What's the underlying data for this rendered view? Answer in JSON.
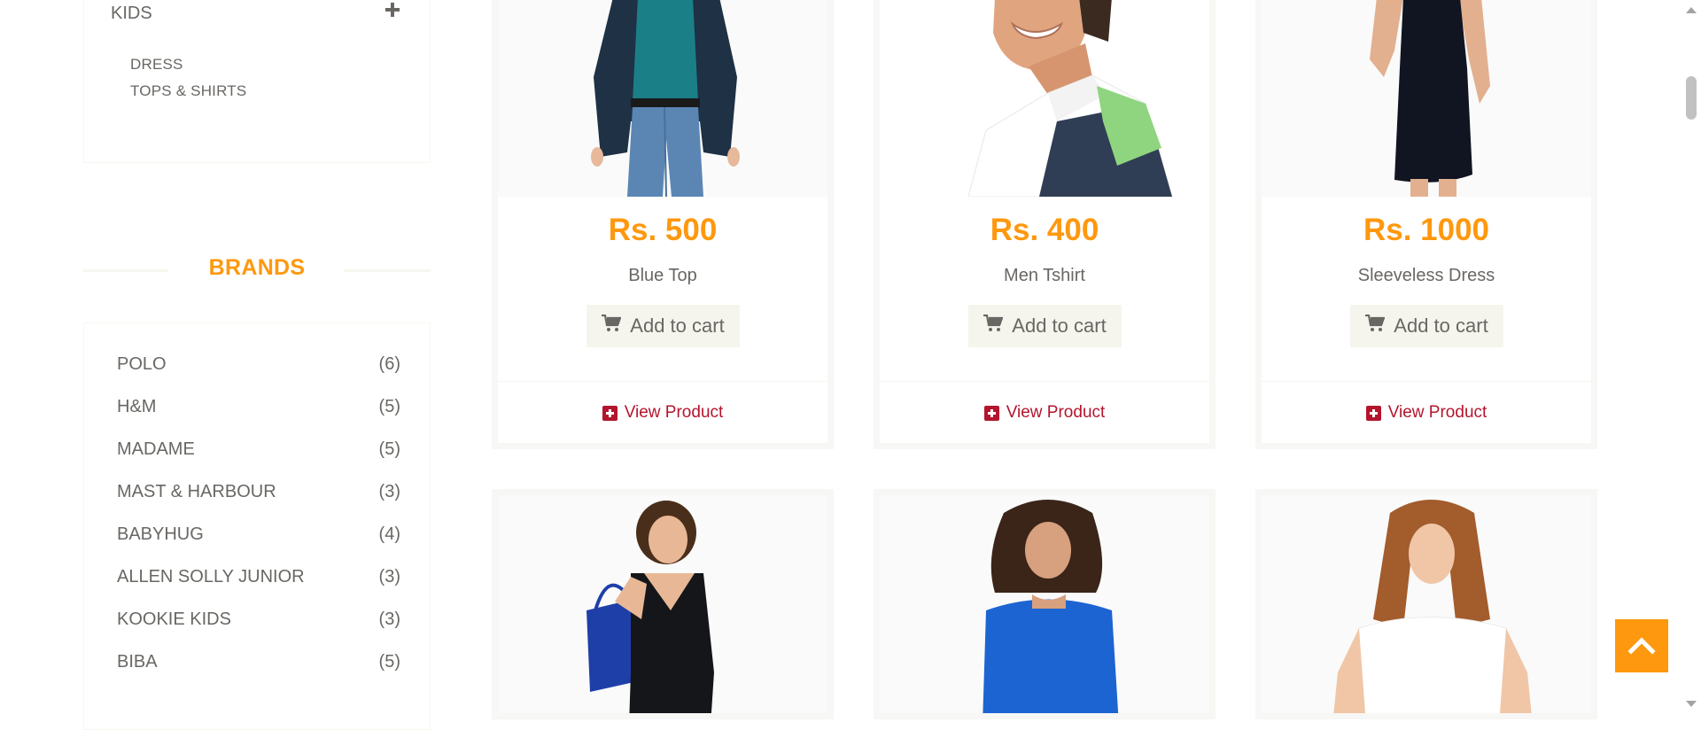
{
  "sidebar": {
    "category": {
      "title": "KIDS",
      "items": [
        "DRESS",
        "TOPS & SHIRTS"
      ]
    },
    "brands": {
      "heading": "BRANDS",
      "items": [
        {
          "name": "POLO",
          "count": "(6)"
        },
        {
          "name": "H&M",
          "count": "(5)"
        },
        {
          "name": "MADAME",
          "count": "(5)"
        },
        {
          "name": "MAST & HARBOUR",
          "count": "(3)"
        },
        {
          "name": "BABYHUG",
          "count": "(4)"
        },
        {
          "name": "ALLEN SOLLY JUNIOR",
          "count": "(3)"
        },
        {
          "name": "KOOKIE KIDS",
          "count": "(3)"
        },
        {
          "name": "BIBA",
          "count": "(5)"
        }
      ]
    }
  },
  "products": [
    {
      "price": "Rs. 500",
      "name": "Blue Top",
      "add_label": "Add to cart",
      "view_label": "View Product"
    },
    {
      "price": "Rs. 400",
      "name": "Men Tshirt",
      "add_label": "Add to cart",
      "view_label": "View Product"
    },
    {
      "price": "Rs. 1000",
      "name": "Sleeveless Dress",
      "add_label": "Add to cart",
      "view_label": "View Product"
    }
  ],
  "icons": {
    "expand": "plus-icon",
    "cart": "shopping-cart-icon",
    "view": "plus-square-icon",
    "scroll_top": "chevron-up-icon"
  },
  "colors": {
    "accent": "#fe980f",
    "link": "#b3152e",
    "text": "#696763",
    "button_bg": "#f5f5ed"
  }
}
